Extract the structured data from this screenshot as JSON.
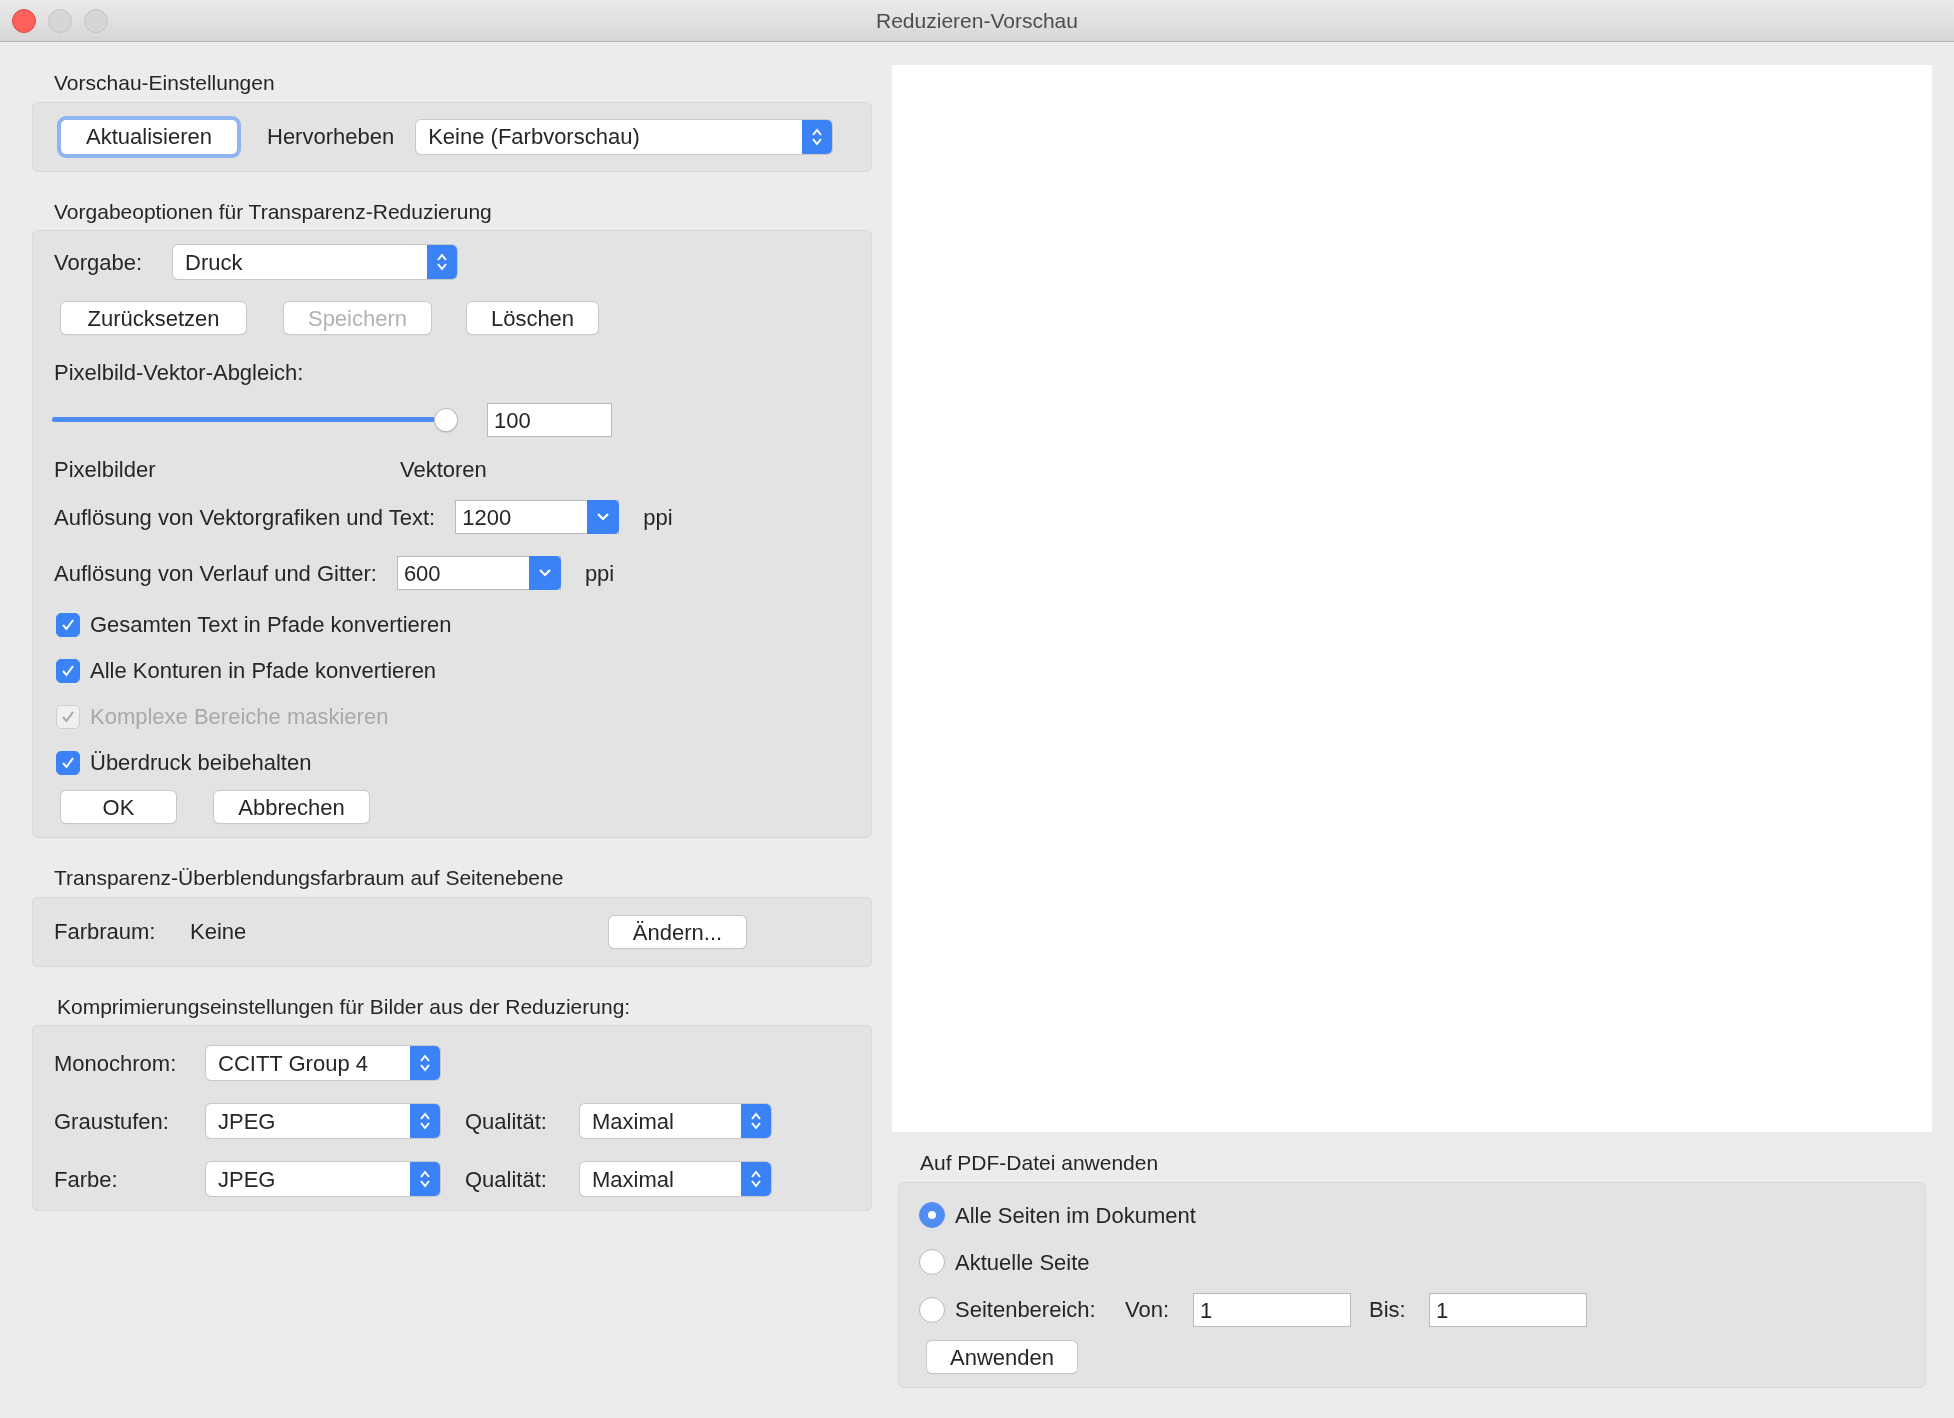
{
  "window": {
    "title": "Reduzieren-Vorschau"
  },
  "preview_settings": {
    "heading": "Vorschau-Einstellungen",
    "refresh_button": {
      "label": "Aktualisieren",
      "focused": true
    },
    "highlight_label": "Hervorheben",
    "highlight_value": "Keine (Farbvorschau)"
  },
  "preset_options": {
    "heading": "Vorgabeoptionen für Transparenz-Reduzierung",
    "preset_label": "Vorgabe:",
    "preset_value": "Druck",
    "preset_buttons": [
      {
        "label": "Zurücksetzen",
        "disabled": false
      },
      {
        "label": "Speichern",
        "disabled": true
      },
      {
        "label": "Löschen",
        "disabled": false
      }
    ],
    "balance_label": "Pixelbild-Vektor-Abgleich:",
    "balance": {
      "level": 1.0,
      "value": "100"
    },
    "min_label": "Pixelbilder",
    "max_label": "Vektoren",
    "resolutions": [
      {
        "label": "Auflösung von Vektorgrafiken und Text:",
        "value": "1200",
        "unit": "ppi"
      },
      {
        "label": "Auflösung von Verlauf und Gitter:",
        "value": "600",
        "unit": "ppi"
      }
    ],
    "checkboxes": [
      {
        "label": "Gesamten Text in Pfade konvertieren",
        "checked": true,
        "disabled": false
      },
      {
        "label": "Alle Konturen in Pfade konvertieren",
        "checked": true,
        "disabled": false
      },
      {
        "label": "Komplexe Bereiche maskieren",
        "checked": true,
        "disabled": true
      },
      {
        "label": "Überdruck beibehalten",
        "checked": true,
        "disabled": false
      }
    ],
    "buttons": [
      "OK",
      "Abbrechen"
    ]
  },
  "blending_space": {
    "heading": "Transparenz-Überblendungsfarbraum auf Seitenebene",
    "label": "Farbraum:",
    "value": "Keine",
    "button": "Ändern..."
  },
  "compression": {
    "heading": "Komprimierungseinstellungen für Bilder aus der Reduzierung:",
    "rows": [
      {
        "label": "Monochrom:",
        "value": "CCITT Group 4"
      },
      {
        "label": "Graustufen:",
        "value": "JPEG",
        "quality_label": "Qualität:",
        "quality": "Maximal"
      },
      {
        "label": "Farbe:",
        "value": "JPEG",
        "quality_label": "Qualität:",
        "quality": "Maximal"
      }
    ]
  },
  "apply": {
    "heading": "Auf PDF-Datei anwenden",
    "options": [
      {
        "kind": "plain",
        "label": "Alle Seiten im Dokument",
        "selected": true
      },
      {
        "kind": "plain",
        "label": "Aktuelle Seite",
        "selected": false
      },
      {
        "kind": "range",
        "label": "Seitenbereich:",
        "selected": false,
        "from_label": "Von:",
        "from": "1",
        "to_label": "Bis:",
        "to": "1"
      }
    ],
    "button": "Anwenden"
  }
}
